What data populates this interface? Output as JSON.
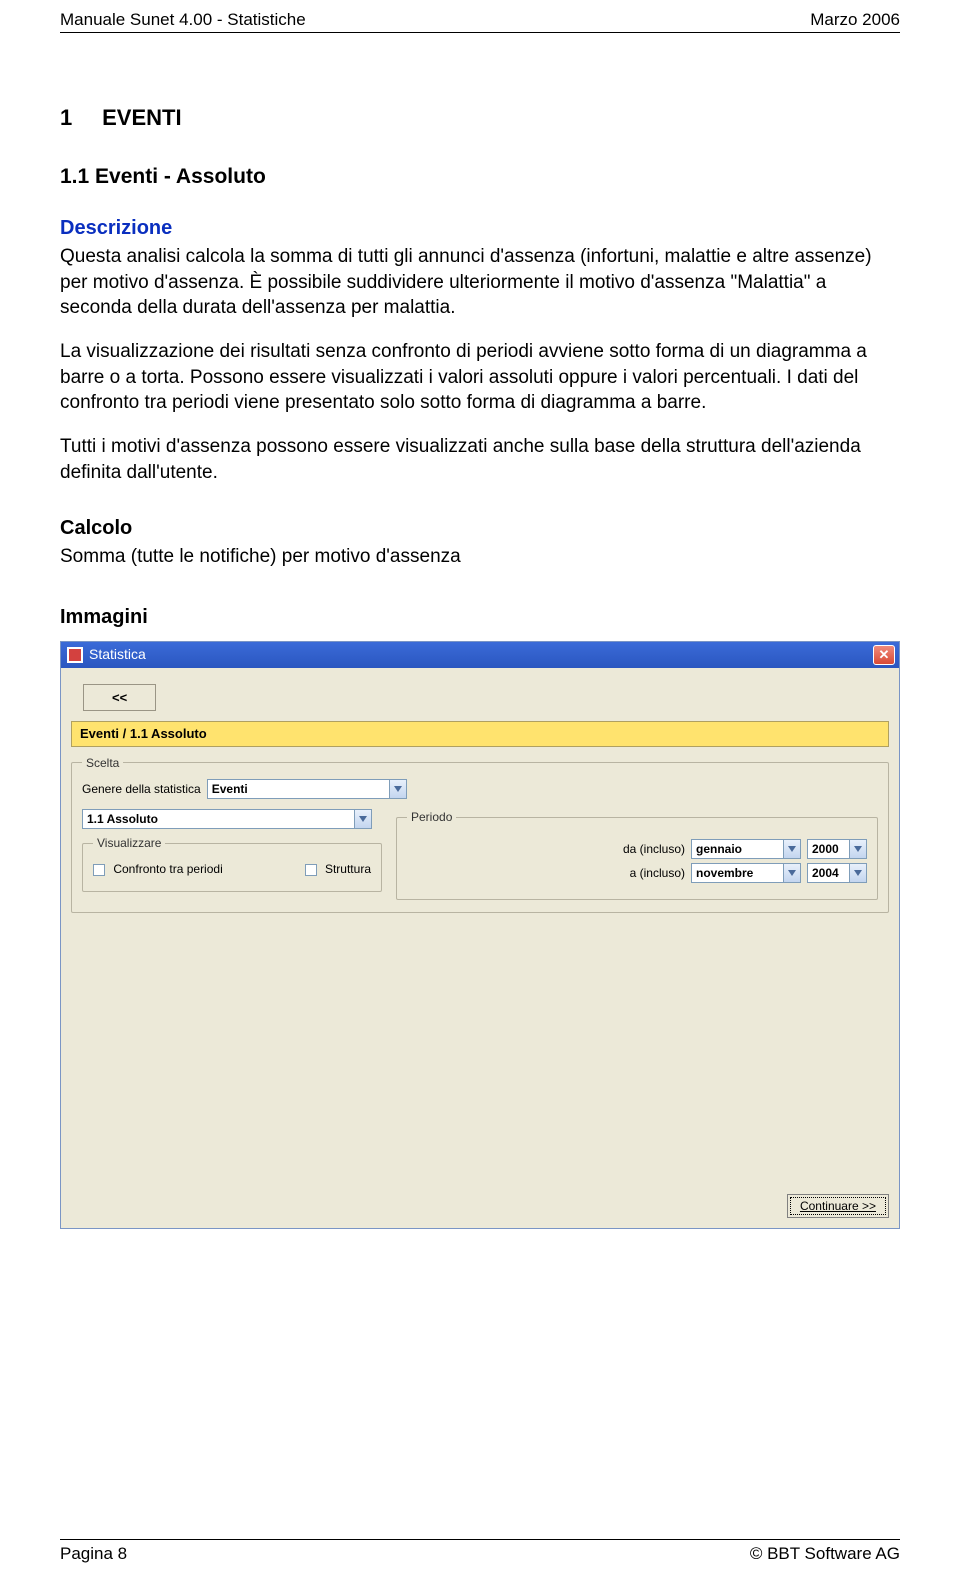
{
  "header": {
    "left": "Manuale Sunet 4.00 - Statistiche",
    "right": "Marzo 2006"
  },
  "section": {
    "h1_num": "1",
    "h1_title": "EVENTI",
    "h2": "1.1   Eventi - Assoluto",
    "descrizione_label": "Descrizione",
    "p1": "Questa analisi calcola la somma di tutti gli annunci d'assenza (infortuni, malattie e altre assenze) per motivo d'assenza. È possibile suddividere ulteriormente il motivo d'assenza \"Malattia\" a seconda della durata dell'assenza per malattia.",
    "p2": "La visualizzazione dei risultati senza confronto di periodi avviene sotto forma di un diagramma a barre o a torta. Possono essere visualizzati i valori assoluti oppure i valori percentuali. I dati del confronto tra periodi viene presentato solo sotto forma di diagramma a barre.",
    "p3": "Tutti i motivi d'assenza possono essere visualizzati anche sulla base della struttura dell'azienda definita dall'utente.",
    "calcolo_label": "Calcolo",
    "calcolo_text": "Somma (tutte le notifiche) per motivo d'assenza",
    "immagini_label": "Immagini"
  },
  "window": {
    "title": "Statistica",
    "back": "<<",
    "breadcrumb": "Eventi / 1.1 Assoluto",
    "scelta_legend": "Scelta",
    "genere_label": "Genere della statistica",
    "genere_value": "Eventi",
    "stat_value": "1.1 Assoluto",
    "visualizzare_legend": "Visualizzare",
    "chk_confronto": "Confronto tra periodi",
    "chk_struttura": "Struttura",
    "periodo_legend": "Periodo",
    "da_label": "da (incluso)",
    "da_month": "gennaio",
    "da_year": "2000",
    "a_label": "a (incluso)",
    "a_month": "novembre",
    "a_year": "2004",
    "continue": "Continuare >>"
  },
  "footer": {
    "left": "Pagina 8",
    "right": "© BBT Software AG"
  }
}
